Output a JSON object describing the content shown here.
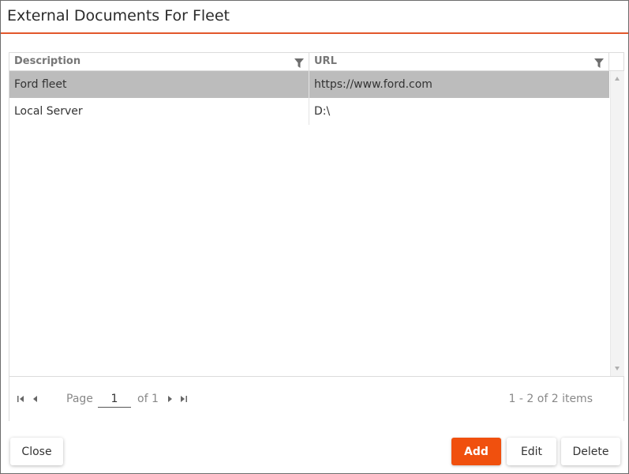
{
  "dialog": {
    "title": "External Documents For Fleet"
  },
  "grid": {
    "columns": [
      {
        "label": "Description"
      },
      {
        "label": "URL"
      }
    ],
    "rows": [
      {
        "description": "Ford fleet",
        "url": "https://www.ford.com",
        "selected": true
      },
      {
        "description": "Local Server",
        "url": "D:\\",
        "selected": false
      }
    ]
  },
  "pager": {
    "page_label": "Page",
    "page_value": "1",
    "of_label": "of 1",
    "items_info": "1 - 2 of 2 items"
  },
  "buttons": {
    "close": "Close",
    "add": "Add",
    "edit": "Edit",
    "delete": "Delete"
  },
  "colors": {
    "accent": "#f0500e",
    "title_underline": "#e2572b",
    "selected_row": "#bcbcbc"
  },
  "icons": {
    "filter": "filter-icon",
    "first_page": "first-page-icon",
    "prev_page": "prev-page-icon",
    "next_page": "next-page-icon",
    "last_page": "last-page-icon"
  }
}
